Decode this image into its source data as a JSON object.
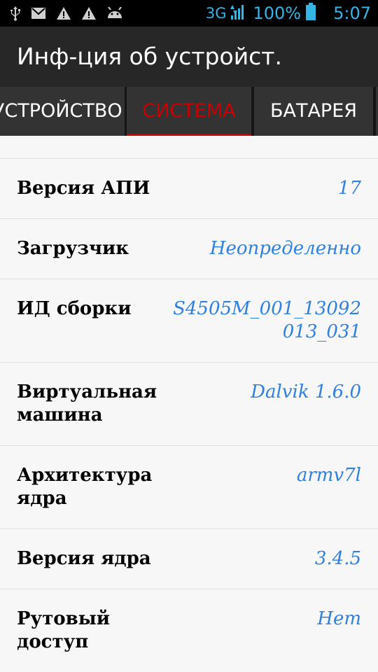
{
  "status_bar": {
    "network": "3G",
    "battery": "100%",
    "time": "5:07",
    "left_icons": [
      "usb-icon",
      "mail-icon",
      "warning-icon",
      "warning-icon",
      "android-icon"
    ]
  },
  "action_bar": {
    "title": "Инф-ция об устройст."
  },
  "tabs": [
    {
      "label": "УСТРОЙСТВО",
      "selected": false
    },
    {
      "label": "СИСТЕМА",
      "selected": true
    },
    {
      "label": "БАТАРЕЯ",
      "selected": false
    }
  ],
  "rows": [
    {
      "label": "Версия АПИ",
      "value": "17"
    },
    {
      "label": "Загрузчик",
      "value": "Неопределенно"
    },
    {
      "label": "ИД сборки",
      "value": "S4505M_001_13092\n013_031"
    },
    {
      "label": "Виртуальная\nмашина",
      "value": "Dalvik 1.6.0"
    },
    {
      "label": "Архитектура\nядра",
      "value": "armv7l"
    },
    {
      "label": "Версия ядра",
      "value": "3.4.5"
    },
    {
      "label": "Рутовый\nдоступ",
      "value": "Нет"
    }
  ],
  "colors": {
    "accent": "#cc0000",
    "value": "#3080e0",
    "status_icons": "#33b5e5",
    "action_bar": "#272727",
    "tab_bg": "#333333"
  }
}
